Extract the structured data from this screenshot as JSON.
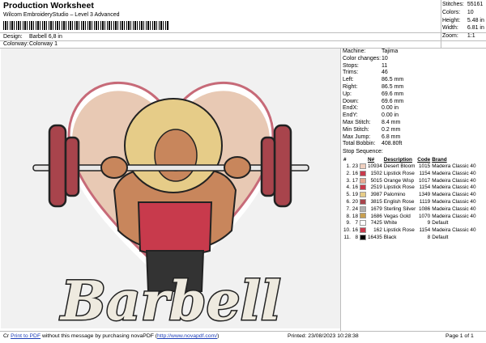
{
  "header": {
    "title": "Production Worksheet",
    "subtitle": "Wilcom EmbroideryStudio – Level 3 Advanced",
    "design_label": "Design:",
    "design_value": "Barbell 6,8 in",
    "colorway_label": "Colorway:",
    "colorway_value": "Colorway 1"
  },
  "summary": [
    {
      "label": "Stitches:",
      "value": "55161"
    },
    {
      "label": "Colors:",
      "value": "10"
    },
    {
      "label": "Height:",
      "value": "5.48 in"
    },
    {
      "label": "Width:",
      "value": "6.81 in"
    },
    {
      "label": "Zoom:",
      "value": "1:1"
    }
  ],
  "machine_info": [
    {
      "label": "Machine:",
      "value": "Tajima"
    },
    {
      "label": "Color changes:",
      "value": "10"
    },
    {
      "label": "Stops:",
      "value": "11"
    },
    {
      "label": "Trims:",
      "value": "46"
    },
    {
      "label": "Left:",
      "value": "86.5 mm"
    },
    {
      "label": "Right:",
      "value": "86.5 mm"
    },
    {
      "label": "Up:",
      "value": "69.6 mm"
    },
    {
      "label": "Down:",
      "value": "69.6 mm"
    },
    {
      "label": "EndX:",
      "value": "0.00 in"
    },
    {
      "label": "EndY:",
      "value": "0.00 in"
    },
    {
      "label": "Max Stitch:",
      "value": "8.4 mm"
    },
    {
      "label": "Min Stitch:",
      "value": "0.2 mm"
    },
    {
      "label": "Max Jump:",
      "value": "6.8 mm"
    },
    {
      "label": "Total Bobbin:",
      "value": "408.80ft"
    }
  ],
  "stop_sequence": {
    "title": "Stop Sequence:",
    "headers": {
      "n": "#",
      "code": "N#",
      "description": "Description",
      "code2": "Code",
      "brand": "Brand"
    },
    "rows": [
      {
        "idx": "1.",
        "stop": "23",
        "color": "#f0d0c0",
        "code": "10934",
        "description": "Desert Bloom",
        "code2": "1015",
        "brand": "Madeira Classic 40"
      },
      {
        "idx": "2.",
        "stop": "16",
        "color": "#c83a4c",
        "code": "1502",
        "description": "Lipstick Rose",
        "code2": "1154",
        "brand": "Madeira Classic 40"
      },
      {
        "idx": "3.",
        "stop": "17",
        "color": "#e8a890",
        "code": "5015",
        "description": "Orange Wisp",
        "code2": "1017",
        "brand": "Madeira Classic 40"
      },
      {
        "idx": "4.",
        "stop": "16",
        "color": "#c83a4c",
        "code": "2519",
        "description": "Lipstick Rose",
        "code2": "1154",
        "brand": "Madeira Classic 40"
      },
      {
        "idx": "5.",
        "stop": "19",
        "color": "#e6cc88",
        "code": "3987",
        "description": "Palomino",
        "code2": "1349",
        "brand": "Madeira Classic 40"
      },
      {
        "idx": "6.",
        "stop": "20",
        "color": "#a8444c",
        "code": "3815",
        "description": "English Rose",
        "code2": "1119",
        "brand": "Madeira Classic 40"
      },
      {
        "idx": "7.",
        "stop": "24",
        "color": "#b0b0b0",
        "code": "1679",
        "description": "Sterling Silver",
        "code2": "1086",
        "brand": "Madeira Classic 40"
      },
      {
        "idx": "8.",
        "stop": "18",
        "color": "#c8a050",
        "code": "1686",
        "description": "Vegas Gold",
        "code2": "1070",
        "brand": "Madeira Classic 40"
      },
      {
        "idx": "9.",
        "stop": "7",
        "color": "#ffffff",
        "code": "7425",
        "description": "White",
        "code2": "9",
        "brand": "Default"
      },
      {
        "idx": "10.",
        "stop": "16",
        "color": "#c83a4c",
        "code": "162",
        "description": "Lipstick Rose",
        "code2": "1154",
        "brand": "Madeira Classic 40"
      },
      {
        "idx": "11.",
        "stop": "8",
        "color": "#000000",
        "code": "16435",
        "description": "Black",
        "code2": "8",
        "brand": "Default"
      }
    ]
  },
  "design_text": "Barbell",
  "footer": {
    "prefix": "Cr",
    "print_link": "Print to PDF",
    "message": " without this message by purchasing novaPDF (",
    "url": "http://www.novapdf.com/",
    "close": ")",
    "printed": "Printed: 23/08/2023 10:28:38",
    "page": "Page 1 of 1"
  }
}
